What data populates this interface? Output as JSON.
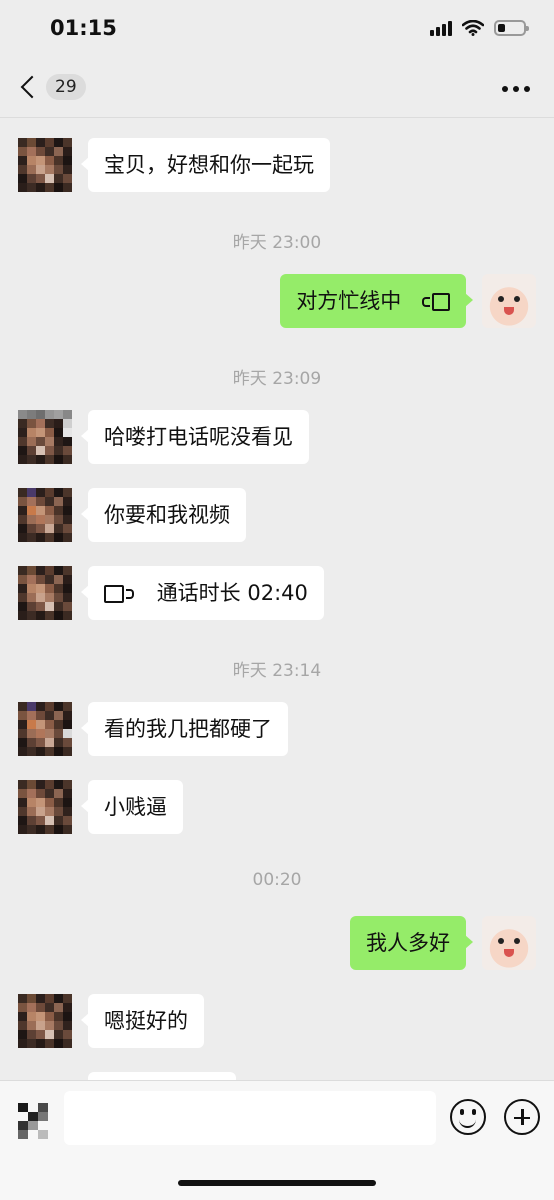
{
  "status_bar": {
    "time": "01:15",
    "icons": [
      "cellular-signal-icon",
      "wifi-icon",
      "battery-icon"
    ],
    "battery_level": 0.3
  },
  "nav": {
    "back_icon": "chevron-left-icon",
    "unread_count": "29",
    "more_icon": "more-dots-icon"
  },
  "messages": [
    {
      "type": "incoming",
      "text": "宝贝，好想和你一起玩"
    },
    {
      "type": "timestamp",
      "text": "昨天 23:00"
    },
    {
      "type": "outgoing",
      "text": "对方忙线中",
      "icon": "video-call-icon"
    },
    {
      "type": "timestamp",
      "text": "昨天 23:09"
    },
    {
      "type": "incoming",
      "text": "哈喽打电话呢没看见"
    },
    {
      "type": "incoming",
      "text": "你要和我视频"
    },
    {
      "type": "incoming",
      "text": "通话时长 02:40",
      "icon": "video-call-icon"
    },
    {
      "type": "timestamp",
      "text": "昨天 23:14"
    },
    {
      "type": "incoming",
      "text": "看的我几把都硬了"
    },
    {
      "type": "incoming",
      "text": "小贱逼"
    },
    {
      "type": "timestamp",
      "text": "00:20"
    },
    {
      "type": "outgoing",
      "text": "我人多好"
    },
    {
      "type": "incoming",
      "text": "嗯挺好的"
    }
  ],
  "input_bar": {
    "placeholder": "",
    "icons": [
      "voice-toggle-icon",
      "emoji-icon",
      "plus-icon"
    ]
  },
  "colors": {
    "background": "#ededed",
    "incoming_bubble": "#ffffff",
    "outgoing_bubble": "#95ec69",
    "timestamp": "#a6a6a6"
  }
}
